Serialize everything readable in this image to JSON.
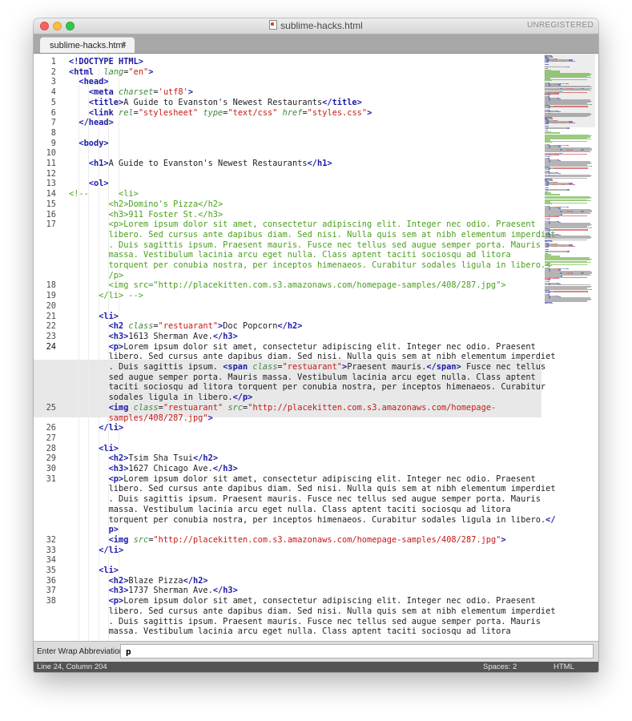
{
  "window": {
    "title": "sublime-hacks.html",
    "license_label": "UNREGISTERED",
    "icons": {
      "close": "close-traffic-light",
      "minimize": "minimize-traffic-light",
      "maximize": "maximize-traffic-light",
      "file": "html-file-icon"
    }
  },
  "tabs": [
    {
      "label": "sublime-hacks.html",
      "close_glyph": "×",
      "active": true
    }
  ],
  "editor": {
    "current_line_number": 24,
    "colors": {
      "tag": "#1a1aa6",
      "attribute": "#3e8a3e",
      "string": "#c41a16",
      "comment": "#4aa01c",
      "text": "#222222"
    },
    "lines": [
      {
        "num": "1",
        "segs": [
          [
            "tg",
            "<!DOCTYPE HTML>"
          ]
        ]
      },
      {
        "num": "2",
        "segs": [
          [
            "tg",
            "<html"
          ],
          [
            "",
            "  "
          ],
          [
            "at",
            "lang"
          ],
          [
            "",
            "="
          ],
          [
            "sv",
            "\"en\""
          ],
          [
            "tg",
            ">"
          ]
        ]
      },
      {
        "num": "3",
        "segs": [
          [
            "",
            "  "
          ],
          [
            "tg",
            "<head>"
          ]
        ]
      },
      {
        "num": "4",
        "segs": [
          [
            "",
            "    "
          ],
          [
            "tg",
            "<meta"
          ],
          [
            "",
            " "
          ],
          [
            "at",
            "charset"
          ],
          [
            "",
            "="
          ],
          [
            "sv",
            "'utf8'"
          ],
          [
            "tg",
            ">"
          ]
        ]
      },
      {
        "num": "5",
        "segs": [
          [
            "",
            "    "
          ],
          [
            "tg",
            "<title>"
          ],
          [
            "",
            "A Guide to Evanston's Newest Restaurants"
          ],
          [
            "tg",
            "</title>"
          ]
        ]
      },
      {
        "num": "6",
        "segs": [
          [
            "",
            "    "
          ],
          [
            "tg",
            "<link"
          ],
          [
            "",
            " "
          ],
          [
            "at",
            "rel"
          ],
          [
            "",
            "="
          ],
          [
            "sv",
            "\"stylesheet\""
          ],
          [
            "",
            " "
          ],
          [
            "at",
            "type"
          ],
          [
            "",
            "="
          ],
          [
            "sv",
            "\"text/css\""
          ],
          [
            "",
            " "
          ],
          [
            "at",
            "href"
          ],
          [
            "",
            "="
          ],
          [
            "sv",
            "\"styles.css\""
          ],
          [
            "tg",
            ">"
          ]
        ]
      },
      {
        "num": "7",
        "segs": [
          [
            "",
            "  "
          ],
          [
            "tg",
            "</head>"
          ]
        ]
      },
      {
        "num": "8",
        "segs": []
      },
      {
        "num": "9",
        "segs": [
          [
            "",
            "  "
          ],
          [
            "tg",
            "<body>"
          ]
        ]
      },
      {
        "num": "10",
        "segs": []
      },
      {
        "num": "11",
        "segs": [
          [
            "",
            "    "
          ],
          [
            "tg",
            "<h1>"
          ],
          [
            "",
            "A Guide to Evanston's Newest Restaurants"
          ],
          [
            "tg",
            "</h1>"
          ]
        ]
      },
      {
        "num": "12",
        "segs": []
      },
      {
        "num": "13",
        "segs": [
          [
            "",
            "    "
          ],
          [
            "tg",
            "<ol>"
          ]
        ]
      },
      {
        "num": "14",
        "segs": [
          [
            "cm",
            "<!--      <li>"
          ]
        ]
      },
      {
        "num": "15",
        "segs": [
          [
            "cm",
            "        <h2>Domino's Pizza</h2>"
          ]
        ]
      },
      {
        "num": "16",
        "segs": [
          [
            "cm",
            "        <h3>911 Foster St.</h3>"
          ]
        ]
      },
      {
        "num": "17",
        "segs": [
          [
            "cm",
            "        <p>Lorem ipsum dolor sit amet, consectetur adipiscing elit. Integer nec odio. Praesent"
          ]
        ]
      },
      {
        "num": "",
        "segs": [
          [
            "cm",
            "        libero. Sed cursus ante dapibus diam. Sed nisi. Nulla quis sem at nibh elementum imperdiet"
          ]
        ]
      },
      {
        "num": "",
        "segs": [
          [
            "cm",
            "        . Duis sagittis ipsum. Praesent mauris. Fusce nec tellus sed augue semper porta. Mauris"
          ]
        ]
      },
      {
        "num": "",
        "segs": [
          [
            "cm",
            "        massa. Vestibulum lacinia arcu eget nulla. Class aptent taciti sociosqu ad litora"
          ]
        ]
      },
      {
        "num": "",
        "segs": [
          [
            "cm",
            "        torquent per conubia nostra, per inceptos himenaeos. Curabitur sodales ligula in libero.<"
          ]
        ]
      },
      {
        "num": "",
        "segs": [
          [
            "cm",
            "        /p>"
          ]
        ]
      },
      {
        "num": "18",
        "segs": [
          [
            "cm",
            "        <img src=\"http://placekitten.com.s3.amazonaws.com/homepage-samples/408/287.jpg\">"
          ]
        ]
      },
      {
        "num": "19",
        "segs": [
          [
            "cm",
            "      </li> -->"
          ]
        ]
      },
      {
        "num": "20",
        "segs": []
      },
      {
        "num": "21",
        "segs": [
          [
            "",
            "      "
          ],
          [
            "tg",
            "<li>"
          ]
        ]
      },
      {
        "num": "22",
        "segs": [
          [
            "",
            "        "
          ],
          [
            "tg",
            "<h2"
          ],
          [
            "",
            " "
          ],
          [
            "at",
            "class"
          ],
          [
            "",
            "="
          ],
          [
            "sv",
            "\"restuarant\""
          ],
          [
            "tg",
            ">"
          ],
          [
            "",
            "Doc Popcorn"
          ],
          [
            "tg",
            "</h2>"
          ]
        ]
      },
      {
        "num": "23",
        "segs": [
          [
            "",
            "        "
          ],
          [
            "tg",
            "<h3>"
          ],
          [
            "",
            "1613 Sherman Ave."
          ],
          [
            "tg",
            "</h3>"
          ]
        ]
      },
      {
        "num": "24",
        "segs": [
          [
            "",
            "        "
          ],
          [
            "tg",
            "<p>"
          ],
          [
            "",
            "Lorem ipsum dolor sit amet, consectetur adipiscing elit. Integer nec odio. Praesent"
          ]
        ]
      },
      {
        "num": "",
        "segs": [
          [
            "",
            "        libero. Sed cursus ante dapibus diam. Sed nisi. Nulla quis sem at nibh elementum imperdiet"
          ]
        ]
      },
      {
        "num": "",
        "segs": [
          [
            "",
            "        . Duis sagittis ipsum. "
          ],
          [
            "tg",
            "<span"
          ],
          [
            "",
            " "
          ],
          [
            "at",
            "class"
          ],
          [
            "",
            "="
          ],
          [
            "sv",
            "\"restuarant\""
          ],
          [
            "tg",
            ">"
          ],
          [
            "",
            "Praesent mauris."
          ],
          [
            "tg",
            "</span>"
          ],
          [
            "",
            " Fusce nec tellus"
          ]
        ]
      },
      {
        "num": "",
        "segs": [
          [
            "",
            "        sed augue semper porta. Mauris massa. Vestibulum lacinia arcu eget nulla. Class aptent"
          ]
        ]
      },
      {
        "num": "",
        "segs": [
          [
            "",
            "        taciti sociosqu ad litora torquent per conubia nostra, per inceptos himenaeos. Curabitur"
          ]
        ]
      },
      {
        "num": "",
        "segs": [
          [
            "",
            "        sodales ligula in libero."
          ],
          [
            "tg",
            "</p>"
          ]
        ]
      },
      {
        "num": "25",
        "segs": [
          [
            "",
            "        "
          ],
          [
            "tg",
            "<img"
          ],
          [
            "",
            " "
          ],
          [
            "at",
            "class"
          ],
          [
            "",
            "="
          ],
          [
            "sv",
            "\"restuarant\""
          ],
          [
            "",
            " "
          ],
          [
            "at",
            "src"
          ],
          [
            "",
            "="
          ],
          [
            "sv",
            "\"http://placekitten.com.s3.amazonaws.com/homepage-"
          ]
        ]
      },
      {
        "num": "",
        "segs": [
          [
            "sv",
            "        samples/408/287.jpg\""
          ],
          [
            "tg",
            ">"
          ]
        ]
      },
      {
        "num": "26",
        "segs": [
          [
            "",
            "      "
          ],
          [
            "tg",
            "</li>"
          ]
        ]
      },
      {
        "num": "27",
        "segs": []
      },
      {
        "num": "28",
        "segs": [
          [
            "",
            "      "
          ],
          [
            "tg",
            "<li>"
          ]
        ]
      },
      {
        "num": "29",
        "segs": [
          [
            "",
            "        "
          ],
          [
            "tg",
            "<h2>"
          ],
          [
            "",
            "Tsim Sha Tsui"
          ],
          [
            "tg",
            "</h2>"
          ]
        ]
      },
      {
        "num": "30",
        "segs": [
          [
            "",
            "        "
          ],
          [
            "tg",
            "<h3>"
          ],
          [
            "",
            "1627 Chicago Ave."
          ],
          [
            "tg",
            "</h3>"
          ]
        ]
      },
      {
        "num": "31",
        "segs": [
          [
            "",
            "        "
          ],
          [
            "tg",
            "<p>"
          ],
          [
            "",
            "Lorem ipsum dolor sit amet, consectetur adipiscing elit. Integer nec odio. Praesent"
          ]
        ]
      },
      {
        "num": "",
        "segs": [
          [
            "",
            "        libero. Sed cursus ante dapibus diam. Sed nisi. Nulla quis sem at nibh elementum imperdiet"
          ]
        ]
      },
      {
        "num": "",
        "segs": [
          [
            "",
            "        . Duis sagittis ipsum. Praesent mauris. Fusce nec tellus sed augue semper porta. Mauris"
          ]
        ]
      },
      {
        "num": "",
        "segs": [
          [
            "",
            "        massa. Vestibulum lacinia arcu eget nulla. Class aptent taciti sociosqu ad litora"
          ]
        ]
      },
      {
        "num": "",
        "segs": [
          [
            "",
            "        torquent per conubia nostra, per inceptos himenaeos. Curabitur sodales ligula in libero."
          ],
          [
            "tg",
            "</"
          ]
        ]
      },
      {
        "num": "",
        "segs": [
          [
            "tg",
            "        p>"
          ]
        ]
      },
      {
        "num": "32",
        "segs": [
          [
            "",
            "        "
          ],
          [
            "tg",
            "<img"
          ],
          [
            "",
            " "
          ],
          [
            "at",
            "src"
          ],
          [
            "",
            "="
          ],
          [
            "sv",
            "\"http://placekitten.com.s3.amazonaws.com/homepage-samples/408/287.jpg\""
          ],
          [
            "tg",
            ">"
          ]
        ]
      },
      {
        "num": "33",
        "segs": [
          [
            "",
            "      "
          ],
          [
            "tg",
            "</li>"
          ]
        ]
      },
      {
        "num": "34",
        "segs": []
      },
      {
        "num": "35",
        "segs": [
          [
            "",
            "      "
          ],
          [
            "tg",
            "<li>"
          ]
        ]
      },
      {
        "num": "36",
        "segs": [
          [
            "",
            "        "
          ],
          [
            "tg",
            "<h2>"
          ],
          [
            "",
            "Blaze Pizza"
          ],
          [
            "tg",
            "</h2>"
          ]
        ]
      },
      {
        "num": "37",
        "segs": [
          [
            "",
            "        "
          ],
          [
            "tg",
            "<h3>"
          ],
          [
            "",
            "1737 Sherman Ave."
          ],
          [
            "tg",
            "</h3>"
          ]
        ]
      },
      {
        "num": "38",
        "segs": [
          [
            "",
            "        "
          ],
          [
            "tg",
            "<p>"
          ],
          [
            "",
            "Lorem ipsum dolor sit amet, consectetur adipiscing elit. Integer nec odio. Praesent"
          ]
        ]
      },
      {
        "num": "",
        "segs": [
          [
            "",
            "        libero. Sed cursus ante dapibus diam. Sed nisi. Nulla quis sem at nibh elementum imperdiet"
          ]
        ]
      },
      {
        "num": "",
        "segs": [
          [
            "",
            "        . Duis sagittis ipsum. Praesent mauris. Fusce nec tellus sed augue semper porta. Mauris"
          ]
        ]
      },
      {
        "num": "",
        "segs": [
          [
            "",
            "        massa. Vestibulum lacinia arcu eget nulla. Class aptent taciti sociosqu ad litora"
          ]
        ]
      }
    ]
  },
  "input_panel": {
    "label": "Enter Wrap Abbreviation:",
    "value": "p"
  },
  "status_bar": {
    "position": "Line 24, Column 204",
    "indentation": "Spaces: 2",
    "syntax": "HTML",
    "background": "#545454"
  }
}
